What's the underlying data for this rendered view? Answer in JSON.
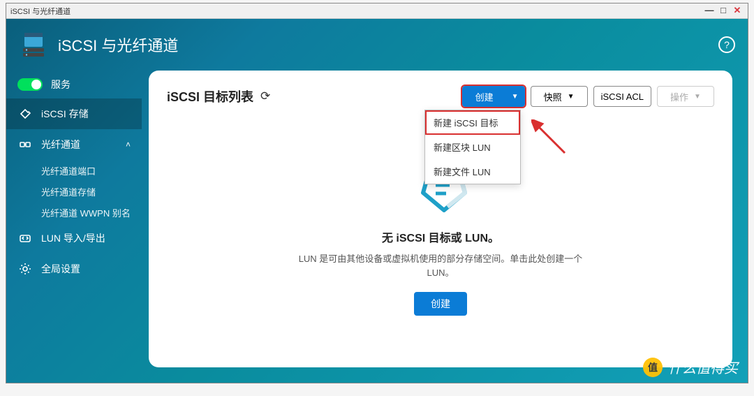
{
  "window": {
    "title": "iSCSI 与光纤通道"
  },
  "header": {
    "title": "iSCSI 与光纤通道"
  },
  "sidebar": {
    "service_label": "服务",
    "items": [
      {
        "label": "iSCSI 存储"
      },
      {
        "label": "光纤通道"
      }
    ],
    "sub": [
      "光纤通道端口",
      "光纤通道存储",
      "光纤通道 WWPN 别名"
    ],
    "lun_io": "LUN 导入/导出",
    "settings": "全局设置"
  },
  "panel": {
    "title": "iSCSI 目标列表"
  },
  "toolbar": {
    "create": "创建",
    "snapshot": "快照",
    "acl": "iSCSI ACL",
    "ops": "操作"
  },
  "dropdown": {
    "items": [
      "新建 iSCSI 目标",
      "新建区块 LUN",
      "新建文件 LUN"
    ]
  },
  "empty": {
    "title": "无 iSCSI 目标或 LUN。",
    "desc": "LUN 是可由其他设备或虚拟机使用的部分存储空间。单击此处创建一个 LUN。",
    "button": "创建"
  },
  "watermark": {
    "badge": "值",
    "text": "什么值得买"
  }
}
